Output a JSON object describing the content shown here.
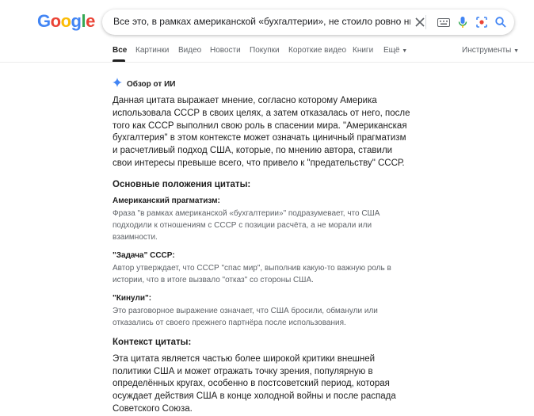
{
  "header": {
    "logo": [
      "G",
      "o",
      "o",
      "g",
      "l",
      "e"
    ],
    "logo_colors": [
      "#4285F4",
      "#EA4335",
      "#FBBC05",
      "#4285F4",
      "#34A853",
      "#EA4335"
    ],
    "search_value": "Все это, в рамках американской «бухгалтерии», не стоило ровно ничего. И как только СССР выполнил"
  },
  "tabs": [
    "Все",
    "Картинки",
    "Видео",
    "Новости",
    "Покупки",
    "Короткие видео",
    "Книги",
    "Ещё"
  ],
  "tools_label": "Инструменты",
  "ai_overview": {
    "title": "Обзор от ИИ",
    "intro": "Данная цитата выражает мнение, согласно которому Америка использовала СССР в своих целях, а затем отказалась от него, после того как СССР выполнил свою роль в спасении мира. \"Американская бухгалтерия\" в этом контексте может означать циничный прагматизм и расчетливый подход США, которые, по мнению автора, ставили свои интересы превыше всего, что привело к \"предательству\" СССР.",
    "section1_title": "Основные положения цитаты:",
    "points": [
      {
        "title": "Американский прагматизм:",
        "text": "Фраза \"в рамках американской «бухгалтерии»\" подразумевает, что США подходили к отношениям с СССР с позиции расчёта, а не морали или взаимности."
      },
      {
        "title": "\"Задача\" СССР:",
        "text": "Автор утверждает, что СССР \"спас мир\", выполнив какую-то важную роль в истории, что в итоге вызвало \"отказ\" со стороны США."
      },
      {
        "title": "\"Кинули\":",
        "text": "Это разговорное выражение означает, что США бросили, обманули или отказались от своего прежнего партнёра после использования."
      }
    ],
    "section2_title": "Контекст цитаты:",
    "context": "Эта цитата является частью более широкой критики внешней политики США и может отражать точку зрения, популярную в определённых кругах, особенно в постсоветский период, которая осуждает действия США в конце холодной войны и после распада Советского Союза."
  }
}
